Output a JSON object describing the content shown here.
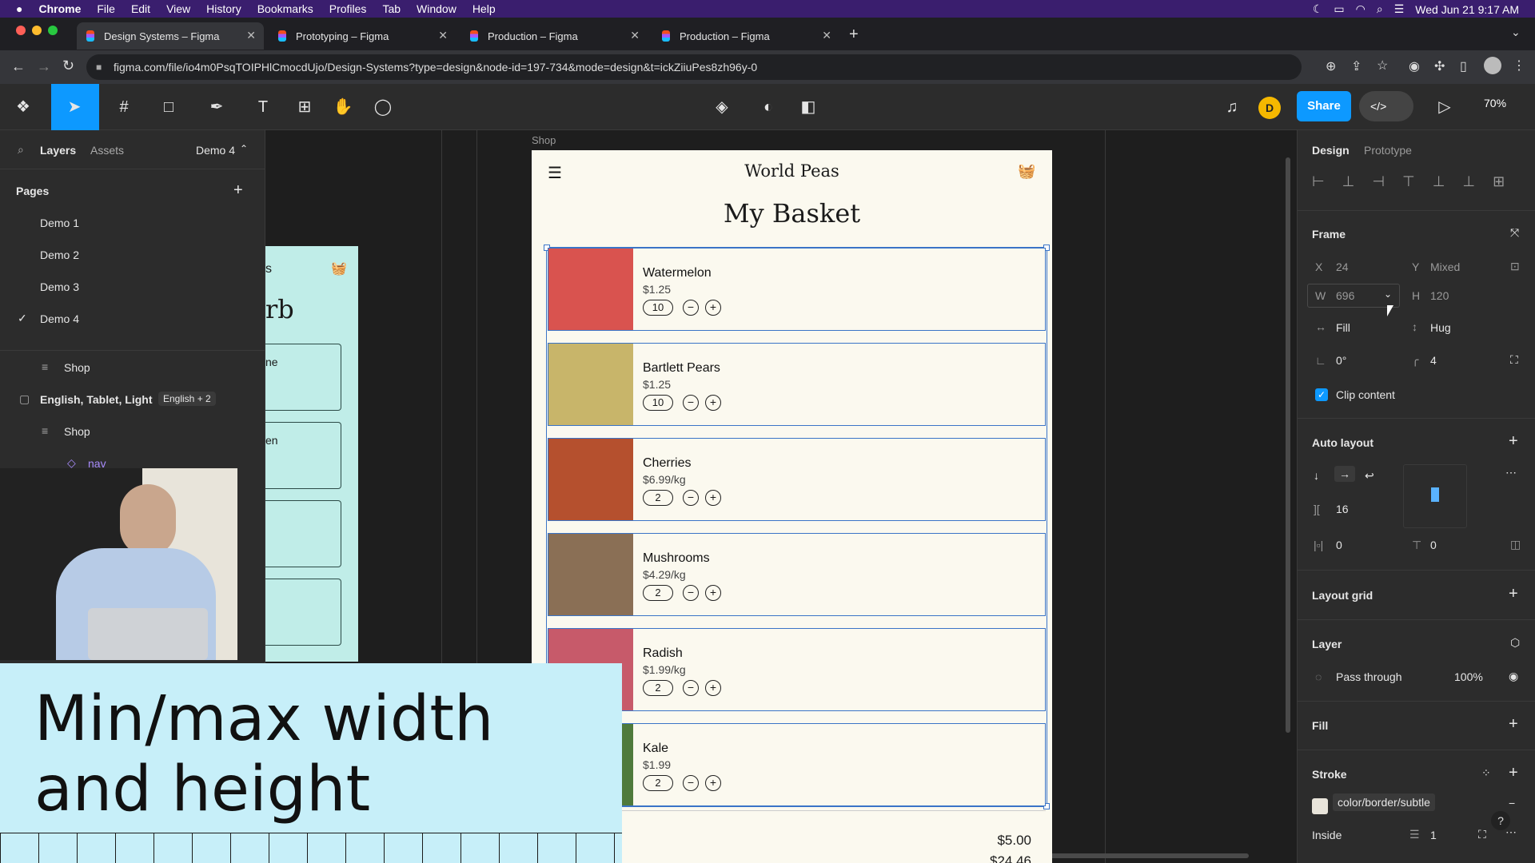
{
  "menubar": {
    "app": "Chrome",
    "items": [
      "File",
      "Edit",
      "View",
      "History",
      "Bookmarks",
      "Profiles",
      "Tab",
      "Window",
      "Help"
    ],
    "datetime": "Wed Jun 21  9:17 AM"
  },
  "tabs": [
    {
      "title": "Design Systems – Figma",
      "active": true
    },
    {
      "title": "Prototyping – Figma",
      "active": false
    },
    {
      "title": "Production – Figma",
      "active": false
    },
    {
      "title": "Production – Figma",
      "active": false
    }
  ],
  "url": "figma.com/file/io4m0PsqTOIPHlCmocdUjo/Design-Systems?type=design&node-id=197-734&mode=design&t=ickZiiuPes8zh96y-0",
  "toolbar": {
    "share": "Share",
    "avatar": "D",
    "zoom": "70%"
  },
  "left_panel": {
    "tab_layers": "Layers",
    "tab_assets": "Assets",
    "page_selector": "Demo 4",
    "pages_label": "Pages",
    "pages": [
      "Demo 1",
      "Demo 2",
      "Demo 3",
      "Demo 4"
    ],
    "layers": [
      {
        "name": "Shop",
        "type": "frame"
      },
      {
        "name": "English, Tablet, Light",
        "badge": "English + 2",
        "type": "section"
      },
      {
        "name": "Shop",
        "type": "frame"
      },
      {
        "name": "nav",
        "type": "component"
      }
    ]
  },
  "canvas": {
    "frame_label": "Shop",
    "left_board_texts": [
      "s",
      "rb",
      "ne",
      "en"
    ],
    "brand": "World Peas",
    "heading": "My Basket",
    "items": [
      {
        "name": "Watermelon",
        "price": "$1.25",
        "qty": "10",
        "color": "#d9534f"
      },
      {
        "name": "Bartlett Pears",
        "price": "$1.25",
        "qty": "10",
        "color": "#c8b56a"
      },
      {
        "name": "Cherries",
        "price": "$6.99/kg",
        "qty": "2",
        "color": "#b5502e"
      },
      {
        "name": "Mushrooms",
        "price": "$4.29/kg",
        "qty": "2",
        "color": "#8a6f55"
      },
      {
        "name": "Radish",
        "price": "$1.99/kg",
        "qty": "2",
        "color": "#c75a6a"
      },
      {
        "name": "Kale",
        "price": "$1.99",
        "qty": "2",
        "color": "#4f7a3c"
      }
    ],
    "subtotal": "$5.00",
    "total_partial": "$24.46"
  },
  "right_panel": {
    "tab_design": "Design",
    "tab_prototype": "Prototype",
    "frame_label": "Frame",
    "x_label": "X",
    "x_value": "24",
    "y_label": "Y",
    "y_value": "Mixed",
    "w_label": "W",
    "w_value": "696",
    "h_label": "H",
    "h_value": "120",
    "w_sizing": "Fill",
    "h_sizing": "Hug",
    "rotation": "0°",
    "radius": "4",
    "clip_content": "Clip content",
    "auto_layout": "Auto layout",
    "gap": "16",
    "pad_h": "0",
    "pad_v": "0",
    "layout_grid": "Layout grid",
    "layer": "Layer",
    "blend": "Pass through",
    "opacity": "100%",
    "fill": "Fill",
    "stroke": "Stroke",
    "stroke_token": "color/border/subtle",
    "stroke_position": "Inside",
    "stroke_weight": "1"
  },
  "overlay": {
    "line1": "Min/max width",
    "line2": "and height"
  }
}
